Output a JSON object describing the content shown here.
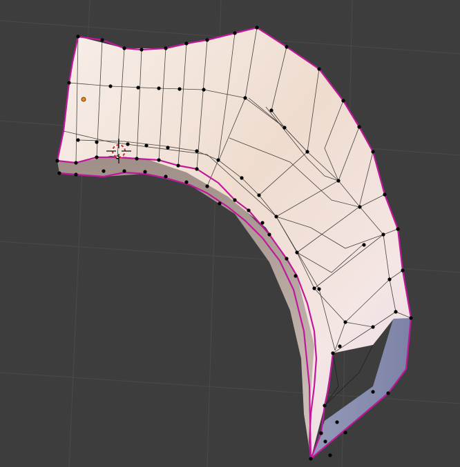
{
  "viewport": {
    "background_color": "#3d3d3d",
    "grid_color": "#4a4a4a",
    "edge_color": "#1a1a1a",
    "vertex_color": "#000000",
    "seam_color": "#c0189a",
    "origin_color": "#f08a16",
    "cursor_colors": [
      "#000000",
      "#ffffff",
      "#d22a2a"
    ],
    "surface_colors": [
      "#f9f0ea",
      "#efd9cd",
      "#e6d7e2"
    ],
    "side_colors": [
      "#8b92b2",
      "#b6a79e"
    ]
  },
  "icons": {
    "cursor": "3d-cursor-icon",
    "origin": "object-origin-icon"
  }
}
